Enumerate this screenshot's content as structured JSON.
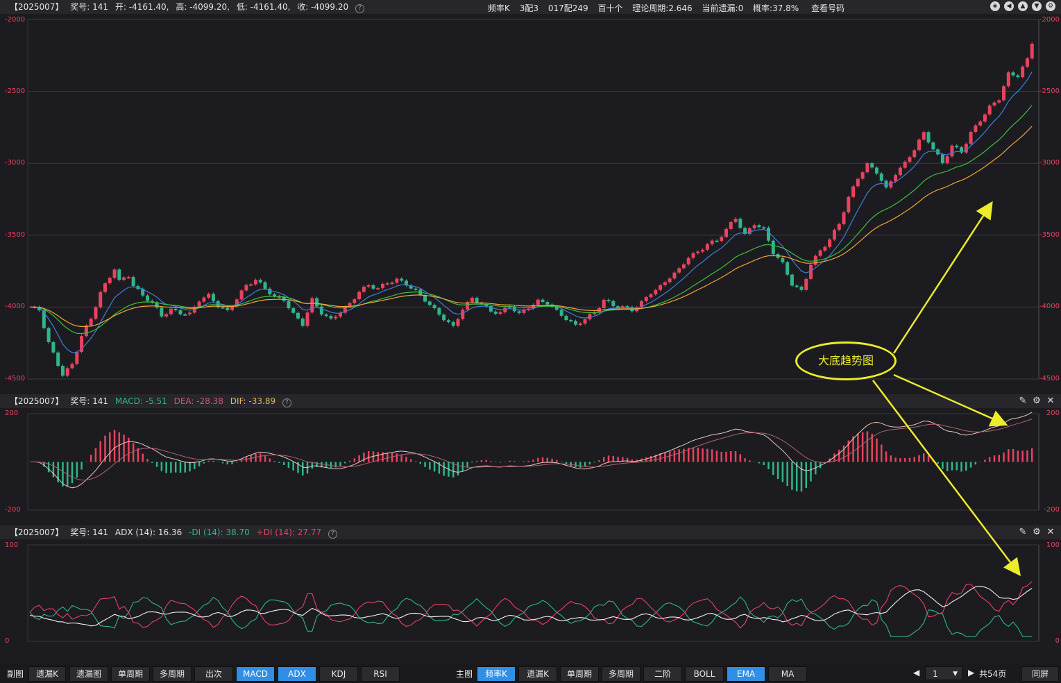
{
  "main_header": {
    "id": "【2025007】",
    "issue": "奖号: 141",
    "open": "开: -4161.40,",
    "high": "高: -4099.20,",
    "low": "低: -4161.40,",
    "close": "收: -4099.20",
    "kind": "频率K",
    "match": "3配3",
    "combo": "017配249",
    "pos": "百十个",
    "period": "理论周期:2.646",
    "omit": "当前遗漏:0",
    "prob": "概率:37.8%",
    "view": "查看号码"
  },
  "macd_header": {
    "id": "【2025007】",
    "issue": "奖号: 141",
    "macd": "MACD: -5.51",
    "dea": "DEA: -28.38",
    "dif": "DIF: -33.89"
  },
  "adx_header": {
    "id": "【2025007】",
    "issue": "奖号: 141",
    "adx": "ADX (14): 16.36",
    "mdi": "-DI (14): 38.70",
    "pdi": "+DI (14): 27.77"
  },
  "main_axis": [
    "-2000",
    "-2500",
    "-3000",
    "-3500",
    "-4000",
    "-4500"
  ],
  "macd_axis": [
    "200",
    "-200"
  ],
  "adx_axis": [
    "100",
    "0"
  ],
  "callout": "大底趋势图",
  "bottom": {
    "left_label": "副图",
    "left_buttons": [
      "遗漏K",
      "遗漏图",
      "单周期",
      "多周期",
      "出次",
      "MACD",
      "ADX",
      "KDJ",
      "RSI"
    ],
    "right_label": "主图",
    "right_buttons": [
      "频率K",
      "遗漏K",
      "单周期",
      "多周期",
      "二阶",
      "BOLL",
      "EMA",
      "MA"
    ],
    "page_value": "1",
    "page_total": "共54页",
    "sync": "同屏"
  },
  "colors": {
    "up": "#e8425e",
    "down": "#2fb58a",
    "ema1": "#3d7de0",
    "ema2": "#3fbf3f",
    "ema3": "#f0a43a",
    "axis": "#e8425e",
    "grid": "#3a3a40",
    "callout": "#ecec2c",
    "accent": "#2f8fe6"
  },
  "chart_data": [
    {
      "type": "candlestick",
      "ylim": [
        -4500,
        -2000
      ],
      "series_note": "",
      "close_path": [
        [
          0,
          -4000
        ],
        [
          2,
          -4020
        ],
        [
          4,
          -4250
        ],
        [
          6,
          -4400
        ],
        [
          7,
          -4470
        ],
        [
          9,
          -4400
        ],
        [
          11,
          -4200
        ],
        [
          13,
          -4080
        ],
        [
          15,
          -3900
        ],
        [
          17,
          -3790
        ],
        [
          18,
          -3730
        ],
        [
          19,
          -3820
        ],
        [
          21,
          -3780
        ],
        [
          22,
          -3850
        ],
        [
          24,
          -3920
        ],
        [
          26,
          -3970
        ],
        [
          28,
          -4060
        ],
        [
          30,
          -4020
        ],
        [
          32,
          -4040
        ],
        [
          34,
          -4050
        ],
        [
          36,
          -3950
        ],
        [
          38,
          -3920
        ],
        [
          40,
          -3990
        ],
        [
          42,
          -4030
        ],
        [
          44,
          -3940
        ],
        [
          46,
          -3850
        ],
        [
          48,
          -3810
        ],
        [
          50,
          -3870
        ],
        [
          52,
          -3930
        ],
        [
          54,
          -3950
        ],
        [
          56,
          -4050
        ],
        [
          58,
          -4120
        ],
        [
          60,
          -3950
        ],
        [
          62,
          -4040
        ],
        [
          64,
          -4090
        ],
        [
          66,
          -4030
        ],
        [
          68,
          -3980
        ],
        [
          70,
          -3890
        ],
        [
          72,
          -3850
        ],
        [
          74,
          -3870
        ],
        [
          76,
          -3830
        ],
        [
          78,
          -3810
        ],
        [
          80,
          -3840
        ],
        [
          82,
          -3890
        ],
        [
          84,
          -3950
        ],
        [
          86,
          -4020
        ],
        [
          88,
          -4080
        ],
        [
          90,
          -4140
        ],
        [
          92,
          -4010
        ],
        [
          94,
          -3940
        ],
        [
          96,
          -3980
        ],
        [
          98,
          -4030
        ],
        [
          100,
          -4040
        ],
        [
          102,
          -3990
        ],
        [
          104,
          -4050
        ],
        [
          106,
          -4000
        ],
        [
          108,
          -3960
        ],
        [
          110,
          -3970
        ],
        [
          112,
          -4030
        ],
        [
          114,
          -4080
        ],
        [
          116,
          -4130
        ],
        [
          118,
          -4080
        ],
        [
          120,
          -4040
        ],
        [
          122,
          -3950
        ],
        [
          124,
          -3990
        ],
        [
          126,
          -4000
        ],
        [
          128,
          -4020
        ],
        [
          130,
          -3970
        ],
        [
          132,
          -3900
        ],
        [
          134,
          -3860
        ],
        [
          136,
          -3790
        ],
        [
          138,
          -3740
        ],
        [
          140,
          -3650
        ],
        [
          142,
          -3620
        ],
        [
          144,
          -3560
        ],
        [
          146,
          -3540
        ],
        [
          148,
          -3460
        ],
        [
          150,
          -3380
        ],
        [
          152,
          -3500
        ],
        [
          154,
          -3420
        ],
        [
          156,
          -3460
        ],
        [
          158,
          -3620
        ],
        [
          160,
          -3700
        ],
        [
          162,
          -3840
        ],
        [
          164,
          -3890
        ],
        [
          166,
          -3700
        ],
        [
          168,
          -3610
        ],
        [
          170,
          -3530
        ],
        [
          172,
          -3420
        ],
        [
          174,
          -3240
        ],
        [
          176,
          -3100
        ],
        [
          178,
          -3010
        ],
        [
          180,
          -3060
        ],
        [
          182,
          -3180
        ],
        [
          184,
          -3070
        ],
        [
          186,
          -3000
        ],
        [
          188,
          -2900
        ],
        [
          190,
          -2790
        ],
        [
          192,
          -2900
        ],
        [
          194,
          -3000
        ],
        [
          196,
          -2880
        ],
        [
          198,
          -2920
        ],
        [
          200,
          -2790
        ],
        [
          202,
          -2700
        ],
        [
          204,
          -2610
        ],
        [
          206,
          -2550
        ],
        [
          208,
          -2380
        ],
        [
          210,
          -2390
        ],
        [
          212,
          -2280
        ],
        [
          213,
          -2160
        ]
      ]
    },
    {
      "type": "line",
      "ylim": [
        -200,
        200
      ],
      "series": [
        {
          "name": "DIF",
          "values": []
        },
        {
          "name": "DEA",
          "values": []
        },
        {
          "name": "MACD",
          "values": []
        }
      ]
    },
    {
      "type": "line",
      "ylim": [
        0,
        100
      ],
      "series": [
        {
          "name": "ADX",
          "values": []
        },
        {
          "name": "-DI",
          "values": []
        },
        {
          "name": "+DI",
          "values": []
        }
      ]
    }
  ]
}
